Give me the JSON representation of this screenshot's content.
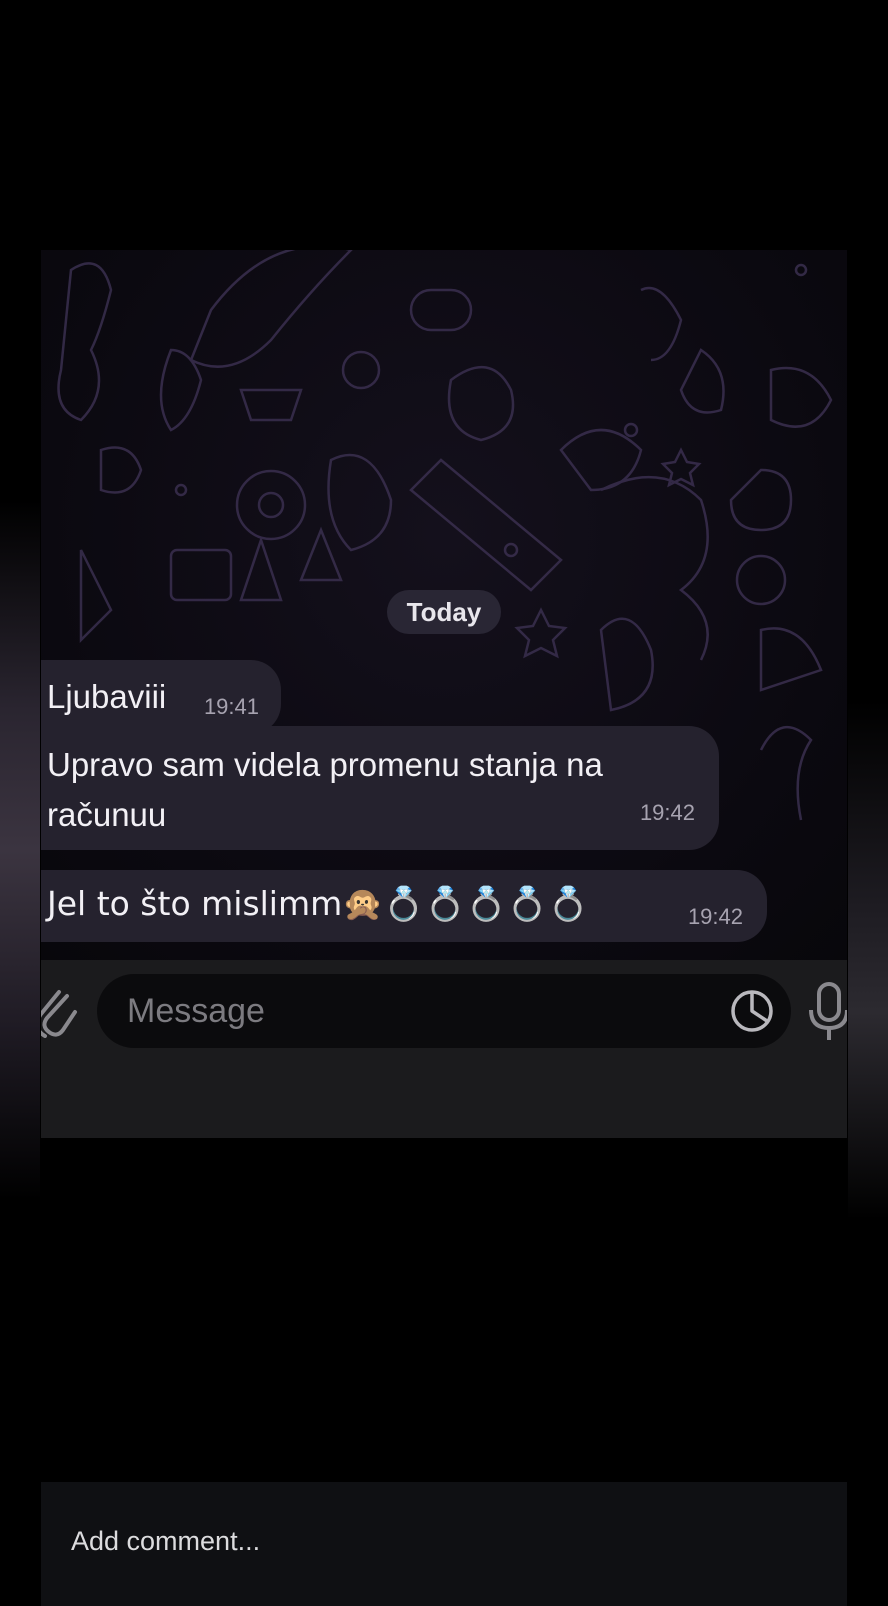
{
  "chat": {
    "date_label": "Today",
    "messages": [
      {
        "text": "Ljubaviii",
        "time": "19:41"
      },
      {
        "text": "Upravo sam videla promenu stanja na\nračunuu",
        "time": "19:42"
      },
      {
        "text": "Jel to što mislimm🙊💍💍💍💍💍",
        "time": "19:42"
      }
    ]
  },
  "composer": {
    "placeholder": "Message"
  },
  "comments": {
    "placeholder": "Add comment..."
  },
  "colors": {
    "background": "#000000",
    "bubble": "#25222e",
    "input_bar": "#1b1b1d"
  },
  "icons": [
    "paperclip-icon",
    "sticker-icon",
    "microphone-icon"
  ]
}
